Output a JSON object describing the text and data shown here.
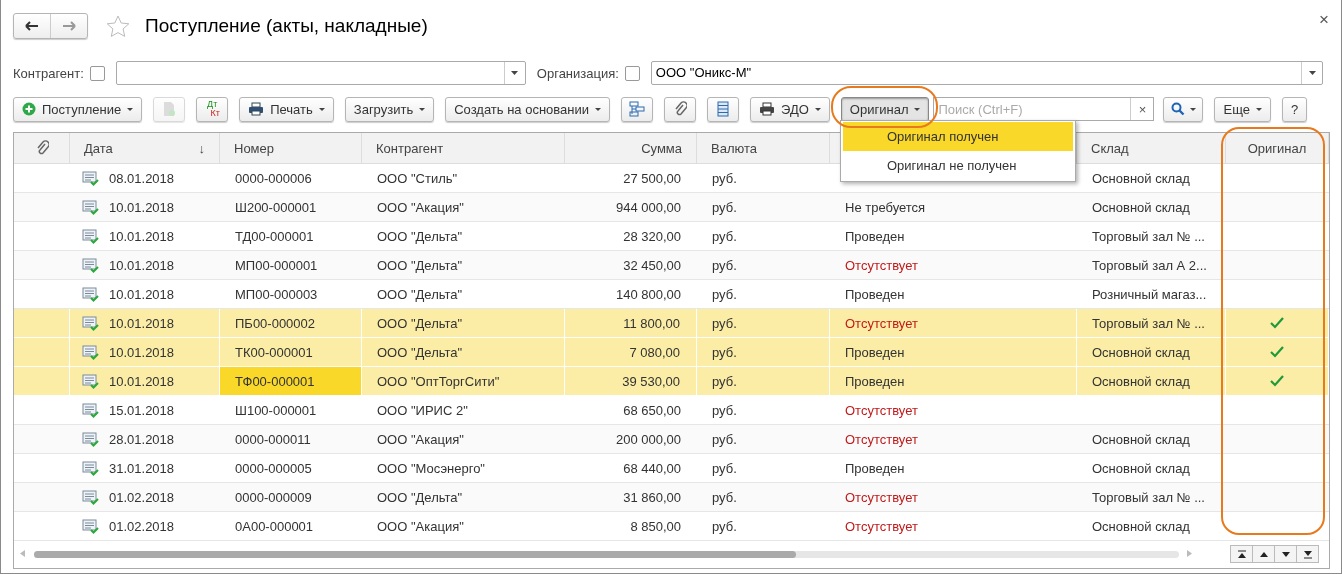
{
  "window": {
    "title": "Поступление (акты, накладные)",
    "close": "×"
  },
  "filters": [
    {
      "label": "Контрагент:",
      "checked": false,
      "kind": "wide"
    },
    {
      "label": "Организация:",
      "checked": false,
      "value": "ООО \"Оникс-М\"",
      "kind": "fill"
    }
  ],
  "toolbar": [
    {
      "kind": "menu",
      "label": "Поступление"
    },
    {
      "kind": "icon",
      "disabled": true
    },
    {
      "kind": "dtkt",
      "top": "Дт",
      "bottom": "Кт"
    },
    {
      "kind": "menu",
      "label": "Печать"
    },
    {
      "kind": "menu",
      "label": "Загрузить"
    },
    {
      "kind": "menu",
      "label": "Создать на основании"
    },
    {
      "kind": "icon",
      "disabled": false
    },
    {
      "kind": "icon",
      "disabled": false
    },
    {
      "kind": "icon",
      "disabled": false
    },
    {
      "kind": "menu",
      "label": "ЭДО"
    },
    {
      "kind": "menu",
      "label": "Оригинал",
      "pressed": true
    },
    {
      "kind": "search",
      "placeholder": "Поиск (Ctrl+F)",
      "clear": "×"
    },
    {
      "kind": "menu"
    },
    {
      "kind": "menu",
      "label": "Еще"
    },
    {
      "kind": "plain",
      "label": "?"
    }
  ],
  "menu": {
    "items": [
      {
        "label": "Оригинал получен",
        "selected": true
      },
      {
        "label": "Оригинал не получен",
        "selected": false
      }
    ]
  },
  "table": {
    "columns": [
      {
        "kind": "clip"
      },
      {
        "label": "Дата",
        "sort": "↓"
      },
      {
        "label": "Номер"
      },
      {
        "label": "Контрагент"
      },
      {
        "label": "Сумма"
      },
      {
        "label": "Валюта"
      },
      {},
      {
        "label": "Склад"
      },
      {
        "label": "Оригинал"
      }
    ],
    "rows": [
      {
        "date": "08.01.2018",
        "number": "0000-000006",
        "counterparty": "ООО \"Стиль\"",
        "sum": "27 500,00",
        "currency": "руб.",
        "warehouse": "Основной склад",
        "original": false,
        "selected": false,
        "current": false
      },
      {
        "date": "10.01.2018",
        "number": "Ш200-000001",
        "counterparty": "ООО \"Акация\"",
        "sum": "944 000,00",
        "currency": "руб.",
        "status": "Не требуется",
        "missing": false,
        "warehouse": "Основной склад",
        "original": false,
        "selected": false,
        "current": false
      },
      {
        "date": "10.01.2018",
        "number": "ТД00-000001",
        "counterparty": "ООО \"Дельта\"",
        "sum": "28 320,00",
        "currency": "руб.",
        "status": "Проведен",
        "missing": false,
        "warehouse": "Торговый зал № ...",
        "original": false,
        "selected": false,
        "current": false
      },
      {
        "date": "10.01.2018",
        "number": "МП00-000001",
        "counterparty": "ООО \"Дельта\"",
        "sum": "32 450,00",
        "currency": "руб.",
        "status": "Отсутствует",
        "missing": true,
        "warehouse": "Торговый зал А 2...",
        "original": false,
        "selected": false,
        "current": false
      },
      {
        "date": "10.01.2018",
        "number": "МП00-000003",
        "counterparty": "ООО \"Дельта\"",
        "sum": "140 800,00",
        "currency": "руб.",
        "status": "Проведен",
        "missing": false,
        "warehouse": "Розничный магаз...",
        "original": false,
        "selected": false,
        "current": false
      },
      {
        "date": "10.01.2018",
        "number": "ПБ00-000002",
        "counterparty": "ООО \"Дельта\"",
        "sum": "11 800,00",
        "currency": "руб.",
        "status": "Отсутствует",
        "missing": true,
        "warehouse": "Торговый зал № ...",
        "original": true,
        "selected": true,
        "current": false
      },
      {
        "date": "10.01.2018",
        "number": "ТК00-000001",
        "counterparty": "ООО \"Дельта\"",
        "sum": "7 080,00",
        "currency": "руб.",
        "status": "Проведен",
        "missing": false,
        "warehouse": "Основной склад",
        "original": true,
        "selected": true,
        "current": false
      },
      {
        "date": "10.01.2018",
        "number": "ТФ00-000001",
        "counterparty": "ООО \"ОптТоргСити\"",
        "sum": "39 530,00",
        "currency": "руб.",
        "status": "Проведен",
        "missing": false,
        "warehouse": "Основной склад",
        "original": true,
        "selected": true,
        "current": true
      },
      {
        "date": "15.01.2018",
        "number": "Ш100-000001",
        "counterparty": "ООО \"ИРИС 2\"",
        "sum": "68 650,00",
        "currency": "руб.",
        "status": "Отсутствует",
        "missing": true,
        "original": false,
        "selected": false,
        "current": false
      },
      {
        "date": "28.01.2018",
        "number": "0000-000011",
        "counterparty": "ООО \"Акация\"",
        "sum": "200 000,00",
        "currency": "руб.",
        "status": "Отсутствует",
        "missing": true,
        "warehouse": "Основной склад",
        "original": false,
        "selected": false,
        "current": false
      },
      {
        "date": "31.01.2018",
        "number": "0000-000005",
        "counterparty": "ООО \"Мосэнерго\"",
        "sum": "68 440,00",
        "currency": "руб.",
        "status": "Проведен",
        "missing": false,
        "warehouse": "Основной склад",
        "original": false,
        "selected": false,
        "current": false
      },
      {
        "date": "01.02.2018",
        "number": "0000-000009",
        "counterparty": "ООО \"Дельта\"",
        "sum": "31 860,00",
        "currency": "руб.",
        "status": "Отсутствует",
        "missing": true,
        "warehouse": "Торговый зал № ...",
        "original": false,
        "selected": false,
        "current": false
      },
      {
        "date": "01.02.2018",
        "number": "0А00-000001",
        "counterparty": "ООО \"Акация\"",
        "sum": "8 850,00",
        "currency": "руб.",
        "status": "Отсутствует",
        "missing": true,
        "warehouse": "Основной склад",
        "original": false,
        "selected": false,
        "current": false
      }
    ]
  }
}
